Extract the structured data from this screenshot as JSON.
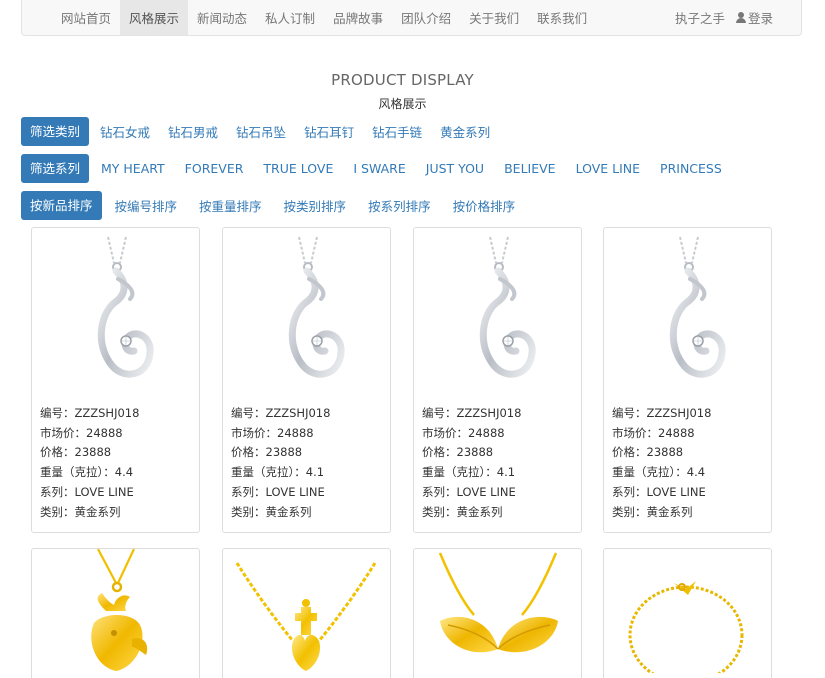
{
  "nav": {
    "items": [
      {
        "label": "网站首页",
        "active": false
      },
      {
        "label": "风格展示",
        "active": true
      },
      {
        "label": "新闻动态",
        "active": false
      },
      {
        "label": "私人订制",
        "active": false
      },
      {
        "label": "品牌故事",
        "active": false
      },
      {
        "label": "团队介绍",
        "active": false
      },
      {
        "label": "关于我们",
        "active": false
      },
      {
        "label": "联系我们",
        "active": false
      }
    ],
    "brand": "执子之手",
    "login": "登录"
  },
  "heading": {
    "title": "PRODUCT DISPLAY",
    "subtitle": "风格展示"
  },
  "filters": {
    "category": {
      "button": "筛选类别",
      "options": [
        "钻石女戒",
        "钻石男戒",
        "钻石吊坠",
        "钻石耳钉",
        "钻石手链",
        "黄金系列"
      ]
    },
    "series": {
      "button": "筛选系列",
      "options": [
        "MY HEART",
        "FOREVER",
        "TRUE LOVE",
        "I SWARE",
        "JUST YOU",
        "BELIEVE",
        "LOVE LINE",
        "PRINCESS"
      ]
    },
    "sort": {
      "button": "按新品排序",
      "options": [
        "按编号排序",
        "按重量排序",
        "按类别排序",
        "按系列排序",
        "按价格排序"
      ]
    }
  },
  "products": [
    {
      "code": "编号：ZZZSHJ018",
      "market_price": "市场价：24888",
      "price": "价格：23888",
      "weight": "重量（克拉）：4.4",
      "series": "系列：LOVE LINE",
      "category": "类别：黄金系列"
    },
    {
      "code": "编号：ZZZSHJ018",
      "market_price": "市场价：24888",
      "price": "价格：23888",
      "weight": "重量（克拉）：4.1",
      "series": "系列：LOVE LINE",
      "category": "类别：黄金系列"
    },
    {
      "code": "编号：ZZZSHJ018",
      "market_price": "市场价：24888",
      "price": "价格：23888",
      "weight": "重量（克拉）：4.1",
      "series": "系列：LOVE LINE",
      "category": "类别：黄金系列"
    },
    {
      "code": "编号：ZZZSHJ018",
      "market_price": "市场价：24888",
      "price": "价格：23888",
      "weight": "重量（克拉）：4.4",
      "series": "系列：LOVE LINE",
      "category": "类别：黄金系列"
    }
  ],
  "second_row_images": [
    "gold-deer-pendant",
    "gold-crown-necklace",
    "gold-leaf-necklace",
    "gold-chain-bracelet"
  ],
  "colors": {
    "accent": "#337ab7",
    "silver": "#c8ccd2",
    "gold": "#f2c200"
  }
}
